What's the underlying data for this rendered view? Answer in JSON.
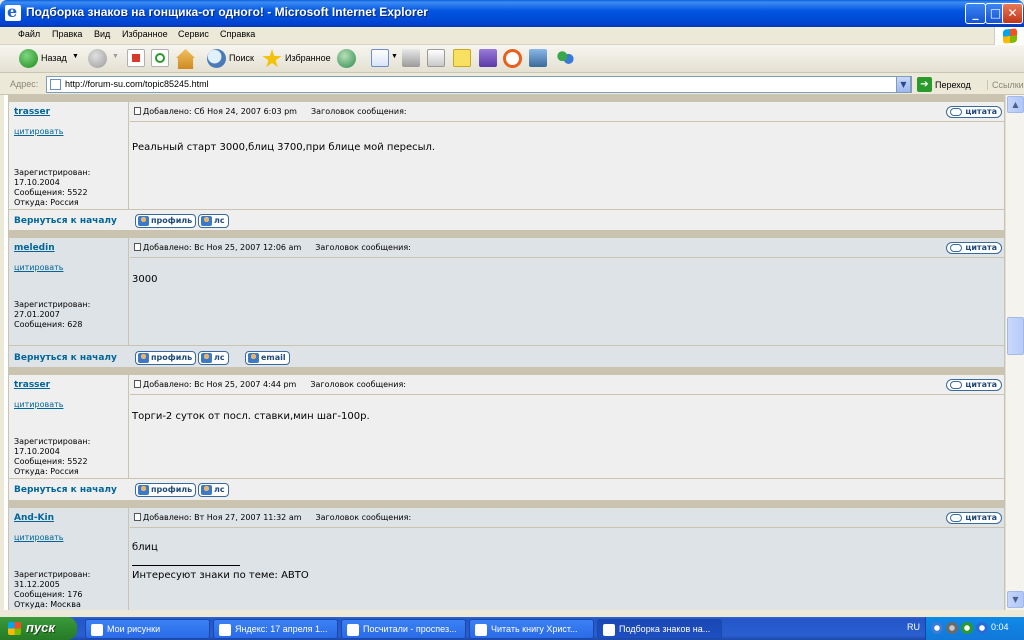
{
  "window": {
    "title": "Подборка знаков на гонщика-от одного! - Microsoft Internet Explorer"
  },
  "menu": [
    "Файл",
    "Правка",
    "Вид",
    "Избранное",
    "Сервис",
    "Справка"
  ],
  "toolbar": {
    "back_label": "Назад",
    "search_label": "Поиск",
    "favorites_label": "Избранное"
  },
  "address": {
    "label": "Адрес:",
    "url": "http://forum-su.com/topic85245.html",
    "go_label": "Переход",
    "links_label": "Ссылки"
  },
  "posts": [
    {
      "author": "trasser",
      "quote_link": "цитировать",
      "header": "Добавлено: Сб Ноя 24, 2007 6:03 pm",
      "subject_label": "Заголовок сообщения:",
      "quote_btn": "цитата",
      "body": "Реальный старт 3000,блиц 3700,при блице мой пересыл.",
      "meta": [
        "Зарегистрирован:",
        "17.10.2004",
        "Сообщения: 5522",
        "Откуда: Россия"
      ],
      "back": "Вернуться к началу",
      "buttons": [
        "профиль",
        "лс"
      ]
    },
    {
      "author": "meledin",
      "quote_link": "цитировать",
      "header": "Добавлено: Вс Ноя 25, 2007 12:06 am",
      "subject_label": "Заголовок сообщения:",
      "quote_btn": "цитата",
      "body": "3000",
      "meta": [
        "Зарегистрирован:",
        "27.01.2007",
        "Сообщения: 628"
      ],
      "back": "Вернуться к началу",
      "buttons": [
        "профиль",
        "лс",
        "email"
      ]
    },
    {
      "author": "trasser",
      "quote_link": "цитировать",
      "header": "Добавлено: Вс Ноя 25, 2007 4:44 pm",
      "subject_label": "Заголовок сообщения:",
      "quote_btn": "цитата",
      "body": "Торги-2 суток от посл. ставки,мин шаг-100р.",
      "meta": [
        "Зарегистрирован:",
        "17.10.2004",
        "Сообщения: 5522",
        "Откуда: Россия"
      ],
      "back": "Вернуться к началу",
      "buttons": [
        "профиль",
        "лс"
      ]
    },
    {
      "author": "And-Kin",
      "quote_link": "цитировать",
      "header": "Добавлено: Вт Ноя 27, 2007 11:32 am",
      "subject_label": "Заголовок сообщения:",
      "quote_btn": "цитата",
      "body": "блиц",
      "signature": "Интересуют знаки по теме: АВТО",
      "meta": [
        "Зарегистрирован:",
        "31.12.2005",
        "Сообщения: 176",
        "Откуда: Москва"
      ]
    }
  ],
  "taskbar": {
    "start_label": "пуск",
    "tasks": [
      "Мои рисунки",
      "Яндекс: 17 апреля 1...",
      "Посчитали - проспез...",
      "Читать книгу Христ...",
      "Подборка знаков на..."
    ],
    "lang": "RU",
    "clock": "0:04"
  }
}
